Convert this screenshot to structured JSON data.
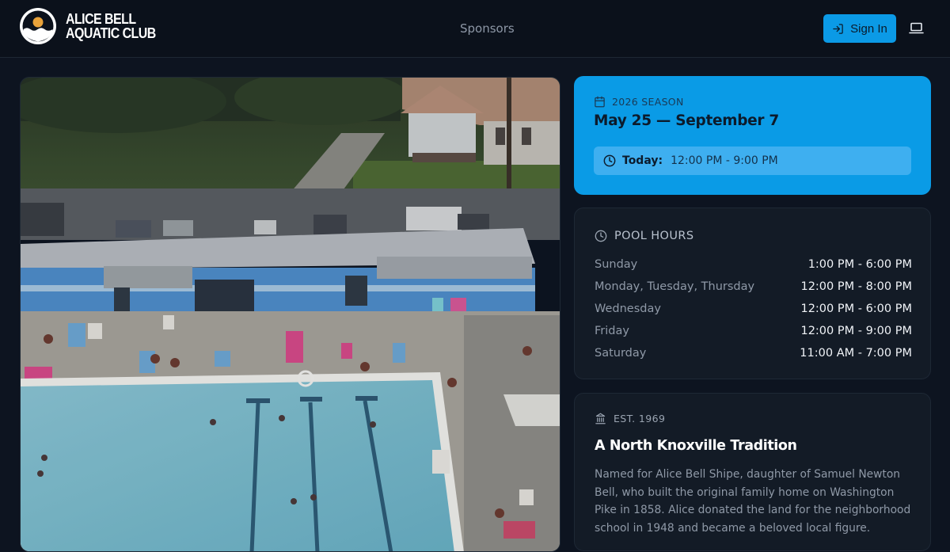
{
  "header": {
    "brand_line1": "ALICE BELL",
    "brand_line2": "AQUATIC CLUB",
    "nav_sponsors": "Sponsors",
    "signin_label": "Sign In"
  },
  "icons": {
    "logo": "sun-over-waves-logo",
    "signin": "sign-in-icon",
    "theme": "laptop-icon",
    "calendar": "calendar-icon",
    "clock": "clock-icon",
    "building": "landmark-icon"
  },
  "colors": {
    "accent": "#0b9ae6",
    "background": "#0d1420",
    "card": "#131b26"
  },
  "photo": {
    "alt": "Aerial view of the pool"
  },
  "season": {
    "eyebrow": "2026 SEASON",
    "dates": "May 25 — September 7",
    "today_label": "Today:",
    "today_time": "12:00 PM - 9:00 PM"
  },
  "hours": {
    "title": "POOL HOURS",
    "rows": [
      {
        "day": "Sunday",
        "time": "1:00 PM - 6:00 PM"
      },
      {
        "day": "Monday, Tuesday, Thursday",
        "time": "12:00 PM - 8:00 PM"
      },
      {
        "day": "Wednesday",
        "time": "12:00 PM - 6:00 PM"
      },
      {
        "day": "Friday",
        "time": "12:00 PM - 9:00 PM"
      },
      {
        "day": "Saturday",
        "time": "11:00 AM - 7:00 PM"
      }
    ]
  },
  "history": {
    "eyebrow": "EST. 1969",
    "title": "A North Knoxville Tradition",
    "body": "Named for Alice Bell Shipe, daughter of Samuel Newton Bell, who built the original family home on Washington Pike in 1858. Alice donated the land for the neighborhood school in 1948 and became a beloved local figure."
  }
}
